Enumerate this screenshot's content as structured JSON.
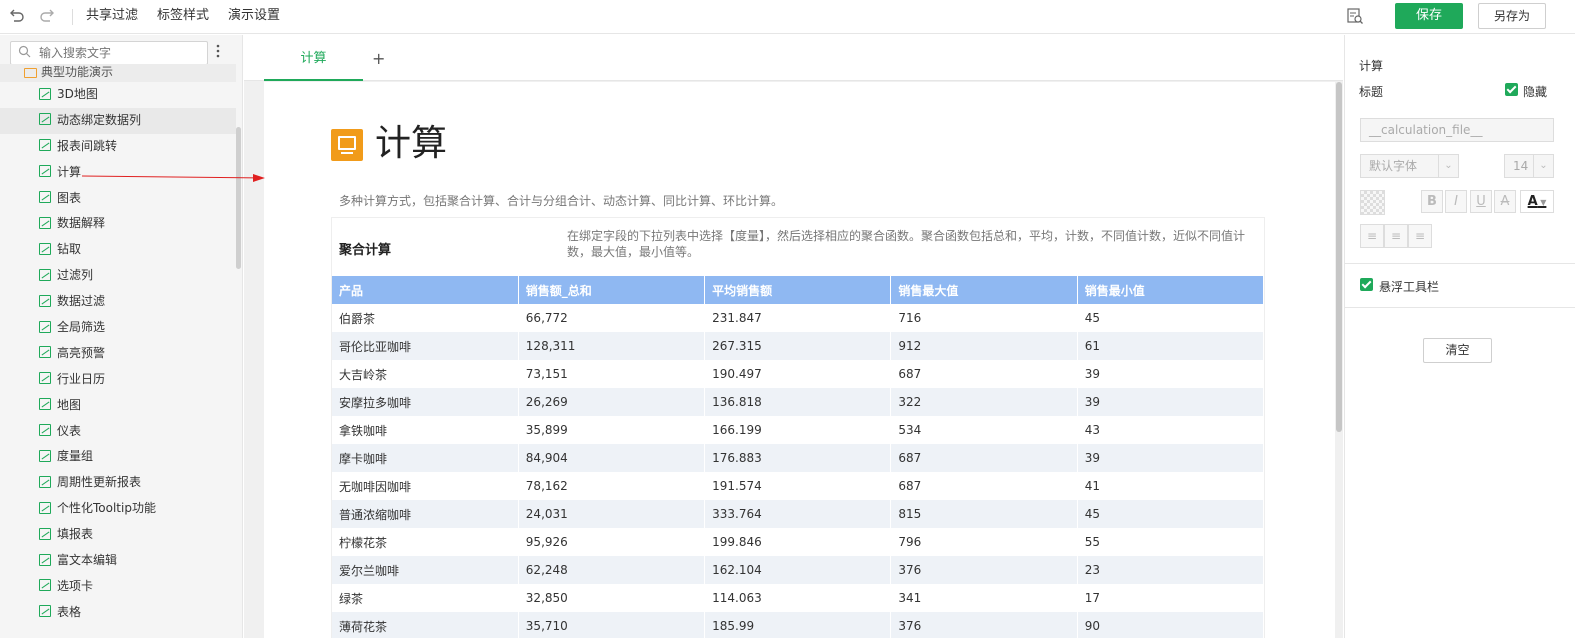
{
  "toolbar": {
    "undo_icon": "undo-icon",
    "redo_icon": "redo-icon",
    "menus": [
      "共享过滤",
      "标签样式",
      "演示设置"
    ],
    "preview_icon": "preview-icon",
    "save_label": "保存",
    "save_as_label": "另存为",
    "accent_color": "#1fa95a"
  },
  "sidebar": {
    "search_placeholder": "输入搜索文字",
    "folder": "典型功能演示",
    "items": [
      {
        "label": "3D地图"
      },
      {
        "label": "动态绑定数据列"
      },
      {
        "label": "报表间跳转"
      },
      {
        "label": "计算"
      },
      {
        "label": "图表"
      },
      {
        "label": "数据解释"
      },
      {
        "label": "钻取"
      },
      {
        "label": "过滤列"
      },
      {
        "label": "数据过滤"
      },
      {
        "label": "全局筛选"
      },
      {
        "label": "高亮预警"
      },
      {
        "label": "行业日历"
      },
      {
        "label": "地图"
      },
      {
        "label": "仪表"
      },
      {
        "label": "度量组"
      },
      {
        "label": "周期性更新报表"
      },
      {
        "label": "个性化Tooltip功能"
      },
      {
        "label": "填报表"
      },
      {
        "label": "富文本编辑"
      },
      {
        "label": "选项卡"
      },
      {
        "label": "表格"
      }
    ]
  },
  "tabs": [
    {
      "label": "计算",
      "active": true
    }
  ],
  "tab_add_label": "+",
  "page": {
    "title": "计算",
    "description": "多种计算方式，包括聚合计算、合计与分组合计、动态计算、同比计算、环比计算。",
    "section_title": "聚合计算",
    "section_desc": "在绑定字段的下拉列表中选择【度量】，然后选择相应的聚合函数。聚合函数包括总和，平均，计数，不同值计数，近似不同值计数，最大值，最小值等。"
  },
  "table": {
    "header_color": "#8fb8f2",
    "columns": [
      "产品",
      "销售额_总和",
      "平均销售额",
      "销售最大值",
      "销售最小值"
    ],
    "rows": [
      [
        "伯爵茶",
        "66,772",
        "231.847",
        "716",
        "45"
      ],
      [
        "哥伦比亚咖啡",
        "128,311",
        "267.315",
        "912",
        "61"
      ],
      [
        "大吉岭茶",
        "73,151",
        "190.497",
        "687",
        "39"
      ],
      [
        "安摩拉多咖啡",
        "26,269",
        "136.818",
        "322",
        "39"
      ],
      [
        "拿铁咖啡",
        "35,899",
        "166.199",
        "534",
        "43"
      ],
      [
        "摩卡咖啡",
        "84,904",
        "176.883",
        "687",
        "39"
      ],
      [
        "无咖啡因咖啡",
        "78,162",
        "191.574",
        "687",
        "41"
      ],
      [
        "普通浓缩咖啡",
        "24,031",
        "333.764",
        "815",
        "45"
      ],
      [
        "柠檬花茶",
        "95,926",
        "199.846",
        "796",
        "55"
      ],
      [
        "爱尔兰咖啡",
        "62,248",
        "162.104",
        "376",
        "23"
      ],
      [
        "绿茶",
        "32,850",
        "114.063",
        "341",
        "17"
      ],
      [
        "薄荷花茶",
        "35,710",
        "185.99",
        "376",
        "90"
      ]
    ]
  },
  "right_panel": {
    "section_label": "计算",
    "title_label": "标题",
    "hide_label": "隐藏",
    "hide_checked": true,
    "title_field_value": "__calculation_file__",
    "font_select": "默认字体",
    "size_select": "14",
    "bold": "B",
    "italic": "I",
    "underline": "U",
    "strike": "A",
    "font_color": "A",
    "float_toolbar_label": "悬浮工具栏",
    "float_toolbar_checked": true,
    "clear_label": "清空"
  }
}
